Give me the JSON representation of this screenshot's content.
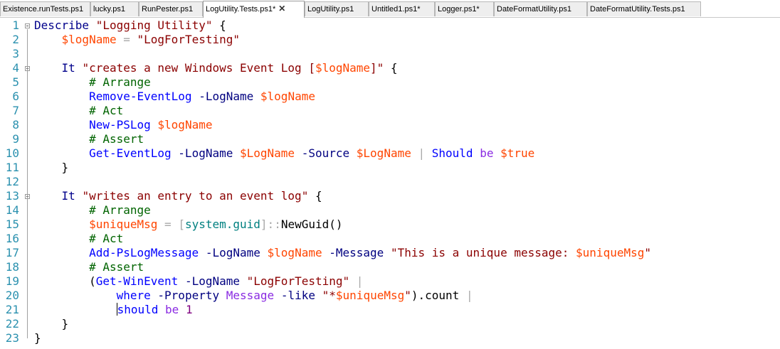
{
  "tabs": [
    {
      "label": "Existence.runTests.ps1",
      "active": false,
      "closable": false
    },
    {
      "label": "lucky.ps1",
      "active": false,
      "closable": false
    },
    {
      "label": "RunPester.ps1",
      "active": false,
      "closable": false
    },
    {
      "label": "LogUtility.Tests.ps1*",
      "active": true,
      "closable": true
    },
    {
      "label": "LogUtility.ps1",
      "active": false,
      "closable": false
    },
    {
      "label": "Untitled1.ps1*",
      "active": false,
      "closable": false
    },
    {
      "label": "Logger.ps1*",
      "active": false,
      "closable": false
    },
    {
      "label": "DateFormatUtility.ps1",
      "active": false,
      "closable": false
    },
    {
      "label": "DateFormatUtility.Tests.ps1",
      "active": false,
      "closable": false
    }
  ],
  "close_glyph": "✕",
  "line_numbers": [
    "1",
    "2",
    "3",
    "4",
    "5",
    "6",
    "7",
    "8",
    "9",
    "10",
    "11",
    "12",
    "13",
    "14",
    "15",
    "16",
    "17",
    "18",
    "19",
    "20",
    "21",
    "22",
    "23"
  ],
  "code_lines": [
    [
      [
        "kw",
        "Describe"
      ],
      [
        "txt",
        " "
      ],
      [
        "str",
        "\"Logging Utility\""
      ],
      [
        "txt",
        " {"
      ]
    ],
    [
      [
        "txt",
        "    "
      ],
      [
        "var",
        "$logName"
      ],
      [
        "txt",
        " "
      ],
      [
        "op",
        "="
      ],
      [
        "txt",
        " "
      ],
      [
        "str",
        "\"LogForTesting\""
      ]
    ],
    [],
    [
      [
        "txt",
        "    "
      ],
      [
        "kw",
        "It"
      ],
      [
        "txt",
        " "
      ],
      [
        "str",
        "\"creates a new Windows Event Log ["
      ],
      [
        "var",
        "$logName"
      ],
      [
        "str",
        "]\""
      ],
      [
        "txt",
        " {"
      ]
    ],
    [
      [
        "txt",
        "        "
      ],
      [
        "cmt",
        "# Arrange"
      ]
    ],
    [
      [
        "txt",
        "        "
      ],
      [
        "cmd",
        "Remove-EventLog"
      ],
      [
        "txt",
        " "
      ],
      [
        "prm",
        "-LogName"
      ],
      [
        "txt",
        " "
      ],
      [
        "var",
        "$logName"
      ]
    ],
    [
      [
        "txt",
        "        "
      ],
      [
        "cmt",
        "# Act"
      ]
    ],
    [
      [
        "txt",
        "        "
      ],
      [
        "cmd",
        "New-PSLog"
      ],
      [
        "txt",
        " "
      ],
      [
        "var",
        "$logName"
      ]
    ],
    [
      [
        "txt",
        "        "
      ],
      [
        "cmt",
        "# Assert"
      ]
    ],
    [
      [
        "txt",
        "        "
      ],
      [
        "cmd",
        "Get-EventLog"
      ],
      [
        "txt",
        " "
      ],
      [
        "prm",
        "-LogName"
      ],
      [
        "txt",
        " "
      ],
      [
        "var",
        "$LogName"
      ],
      [
        "txt",
        " "
      ],
      [
        "prm",
        "-Source"
      ],
      [
        "txt",
        " "
      ],
      [
        "var",
        "$LogName"
      ],
      [
        "txt",
        " "
      ],
      [
        "op",
        "|"
      ],
      [
        "txt",
        " "
      ],
      [
        "cmd",
        "Should"
      ],
      [
        "txt",
        " "
      ],
      [
        "mprop",
        "be"
      ],
      [
        "txt",
        " "
      ],
      [
        "var",
        "$true"
      ]
    ],
    [
      [
        "txt",
        "    }"
      ]
    ],
    [],
    [
      [
        "txt",
        "    "
      ],
      [
        "kw",
        "It"
      ],
      [
        "txt",
        " "
      ],
      [
        "str",
        "\"writes an entry to an event log\""
      ],
      [
        "txt",
        " {"
      ]
    ],
    [
      [
        "txt",
        "        "
      ],
      [
        "cmt",
        "# Arrange"
      ]
    ],
    [
      [
        "txt",
        "        "
      ],
      [
        "var",
        "$uniqueMsg"
      ],
      [
        "txt",
        " "
      ],
      [
        "op",
        "="
      ],
      [
        "txt",
        " "
      ],
      [
        "op",
        "["
      ],
      [
        "typ",
        "system.guid"
      ],
      [
        "op",
        "]::"
      ],
      [
        "mem",
        "NewGuid"
      ],
      [
        "txt",
        "()"
      ]
    ],
    [
      [
        "txt",
        "        "
      ],
      [
        "cmt",
        "# Act"
      ]
    ],
    [
      [
        "txt",
        "        "
      ],
      [
        "cmd",
        "Add-PsLogMessage"
      ],
      [
        "txt",
        " "
      ],
      [
        "prm",
        "-LogName"
      ],
      [
        "txt",
        " "
      ],
      [
        "var",
        "$logName"
      ],
      [
        "txt",
        " "
      ],
      [
        "prm",
        "-Message"
      ],
      [
        "txt",
        " "
      ],
      [
        "str",
        "\"This is a unique message: "
      ],
      [
        "var",
        "$uniqueMsg"
      ],
      [
        "str",
        "\""
      ]
    ],
    [
      [
        "txt",
        "        "
      ],
      [
        "cmt",
        "# Assert"
      ]
    ],
    [
      [
        "txt",
        "        ("
      ],
      [
        "cmd",
        "Get-WinEvent"
      ],
      [
        "txt",
        " "
      ],
      [
        "prm",
        "-LogName"
      ],
      [
        "txt",
        " "
      ],
      [
        "str",
        "\"LogForTesting\""
      ],
      [
        "txt",
        " "
      ],
      [
        "op",
        "|"
      ]
    ],
    [
      [
        "txt",
        "            "
      ],
      [
        "cmd",
        "where"
      ],
      [
        "txt",
        " "
      ],
      [
        "prm",
        "-Property"
      ],
      [
        "txt",
        " "
      ],
      [
        "mprop",
        "Message"
      ],
      [
        "txt",
        " "
      ],
      [
        "prm",
        "-like"
      ],
      [
        "txt",
        " "
      ],
      [
        "str",
        "\"*"
      ],
      [
        "var",
        "$uniqueMsg"
      ],
      [
        "str",
        "\""
      ],
      [
        "txt",
        ")."
      ],
      [
        "mem",
        "count"
      ],
      [
        "txt",
        " "
      ],
      [
        "op",
        "|"
      ]
    ],
    [
      [
        "txt",
        "            "
      ],
      [
        "caret",
        ""
      ],
      [
        "cmd",
        "should"
      ],
      [
        "txt",
        " "
      ],
      [
        "mprop",
        "be"
      ],
      [
        "txt",
        " "
      ],
      [
        "num",
        "1"
      ]
    ],
    [
      [
        "txt",
        "    }"
      ]
    ],
    [
      [
        "txt",
        "}"
      ]
    ]
  ]
}
